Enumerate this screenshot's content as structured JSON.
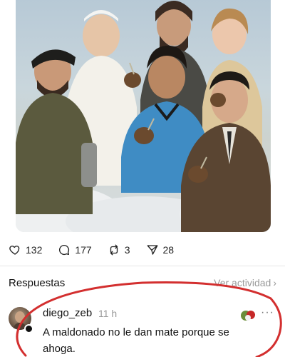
{
  "post": {
    "image_alt": "Painting of six smiling men and a woman sitting on clouds holding mate gourds"
  },
  "actions": {
    "likes": "132",
    "comments": "177",
    "reposts": "3",
    "shares": "28"
  },
  "replies": {
    "title": "Respuestas",
    "view_activity": "Ver actividad",
    "chevron": "›"
  },
  "reply": {
    "username": "diego_zeb",
    "time": "11 h",
    "text": "A maldonado no le dan mate porque se ahoga."
  },
  "colors": {
    "annotation_red": "#d32f2f",
    "muted_text": "#9a9a9a"
  }
}
